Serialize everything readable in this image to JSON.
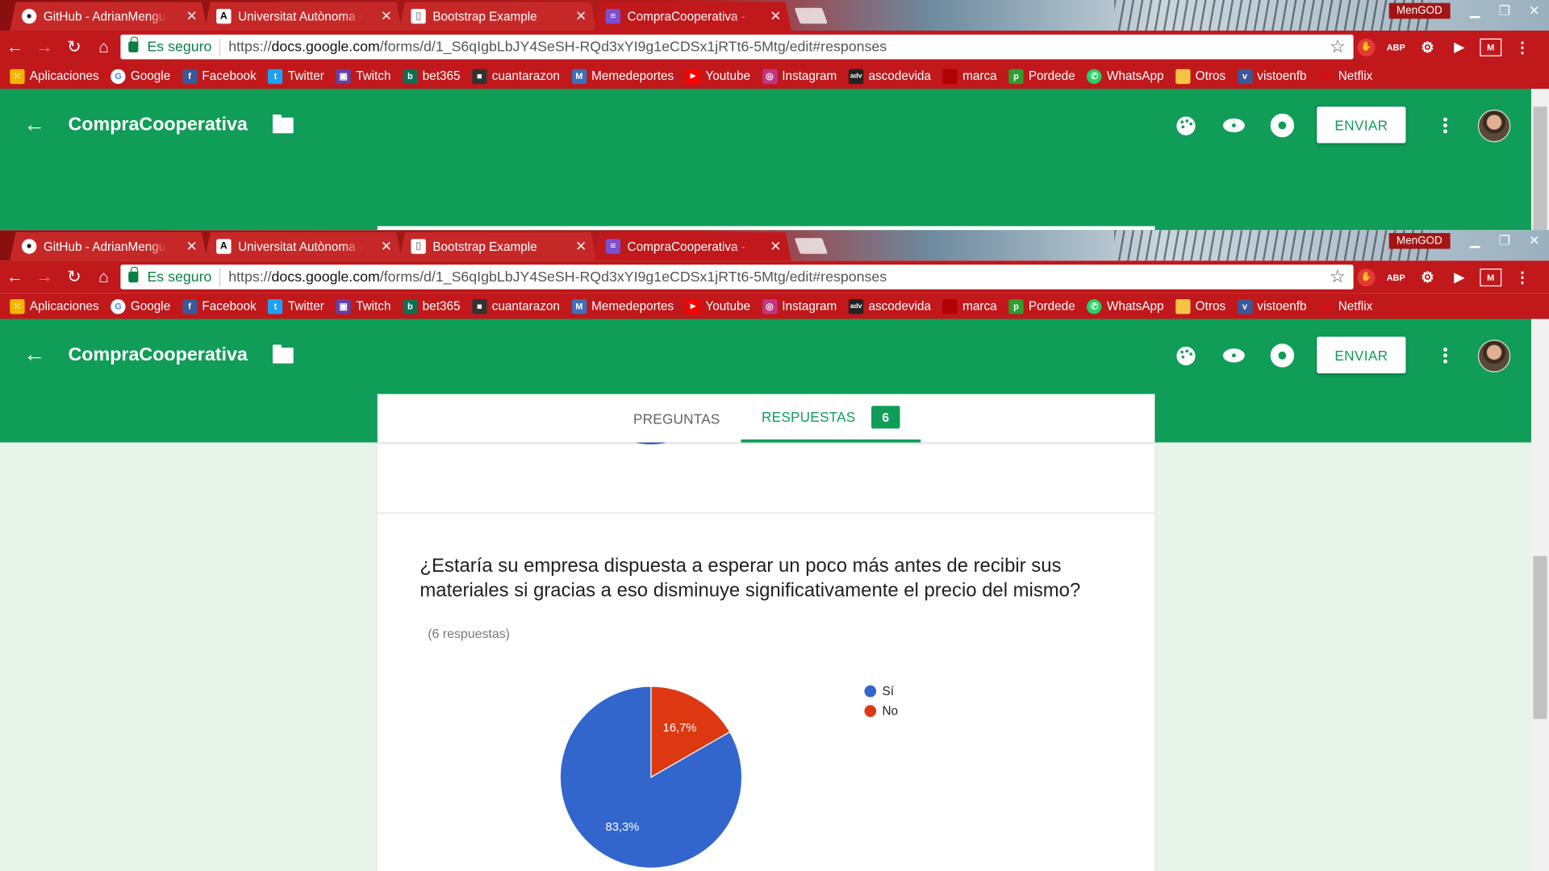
{
  "browser": {
    "tabs": [
      {
        "title": "GitHub - AdrianMengual",
        "icon": "github-icon",
        "active": false
      },
      {
        "title": "Universitat Autònoma de",
        "icon": "uab-icon",
        "active": false
      },
      {
        "title": "Bootstrap Example",
        "icon": "page-icon",
        "active": false
      },
      {
        "title": "CompraCooperativa - Fo",
        "icon": "forms-icon",
        "active": true
      }
    ],
    "profile": "MenGOD",
    "security_label": "Es seguro",
    "url_scheme": "https://",
    "url_host": "docs.google.com",
    "url_path": "/forms/d/1_S6qIgbLbJY4SeSH-RQd3xYI9g1eCDSx1jRTt6-5Mtg/edit#responses",
    "extensions": [
      {
        "name": "adblock-icon",
        "label": ""
      },
      {
        "name": "abp-icon",
        "label": "ABP"
      },
      {
        "name": "extension-gear-icon",
        "label": ""
      },
      {
        "name": "cast-icon",
        "label": ""
      },
      {
        "name": "movistar-icon",
        "label": "M"
      },
      {
        "name": "menu-icon",
        "label": ""
      }
    ],
    "bookmarks": [
      {
        "label": "Aplicaciones",
        "icon": "apps-icon",
        "color": "#f4b400"
      },
      {
        "label": "Google",
        "icon": "google-icon",
        "color": "#4285f4"
      },
      {
        "label": "Facebook",
        "icon": "facebook-icon",
        "color": "#3b5998"
      },
      {
        "label": "Twitter",
        "icon": "twitter-icon",
        "color": "#1da1f2"
      },
      {
        "label": "Twitch",
        "icon": "twitch-icon",
        "color": "#6441a5"
      },
      {
        "label": "bet365",
        "icon": "bet365-icon",
        "color": "#126e51"
      },
      {
        "label": "cuantarazon",
        "icon": "cuantarazon-icon",
        "color": "#333333"
      },
      {
        "label": "Memedeportes",
        "icon": "memedeportes-icon",
        "color": "#3f6fb6"
      },
      {
        "label": "Youtube",
        "icon": "youtube-icon",
        "color": "#ff0000"
      },
      {
        "label": "Instagram",
        "icon": "instagram-icon",
        "color": "#c13584"
      },
      {
        "label": "ascodevida",
        "icon": "ascodevida-icon",
        "color": "#222222"
      },
      {
        "label": "marca",
        "icon": "marca-icon",
        "color": "#b20000"
      },
      {
        "label": "Pordede",
        "icon": "pordede-icon",
        "color": "#2e9e2e"
      },
      {
        "label": "WhatsApp",
        "icon": "whatsapp-icon",
        "color": "#25d366"
      },
      {
        "label": "Otros",
        "icon": "folder-icon",
        "color": "#f6c344"
      },
      {
        "label": "vistoenfb",
        "icon": "vistoenfb-icon",
        "color": "#3b5998"
      },
      {
        "label": "Netflix",
        "icon": "netflix-icon",
        "color": "#e50914"
      }
    ]
  },
  "form": {
    "title": "CompraCooperativa",
    "send_label": "ENVIAR",
    "tab_questions": "PREGUNTAS",
    "tab_responses": "RESPUESTAS",
    "responses_count": "6",
    "question": "¿Estaría su empresa dispuesta a esperar un poco más antes de recibir sus materiales si gracias a eso disminuye significativamente el precio del mismo?",
    "responses_text": "(6 respuestas)"
  },
  "colors": {
    "header_green": "#0f9d58",
    "chrome_red": "#c0181b",
    "pie_si": "#3366cc",
    "pie_no": "#dc3912"
  },
  "chart_data": {
    "type": "pie",
    "title": "",
    "categories": [
      "Sí",
      "No"
    ],
    "values": [
      83.3,
      16.7
    ],
    "value_labels": [
      "83,3%",
      "16,7%"
    ],
    "legend_position": "right"
  }
}
